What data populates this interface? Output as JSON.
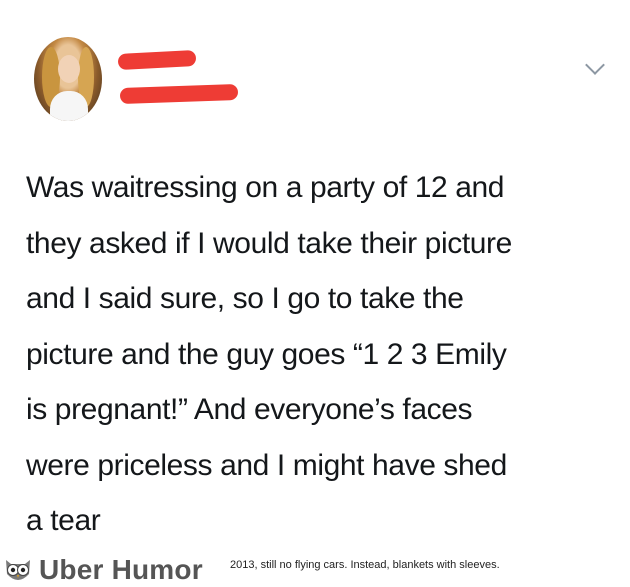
{
  "tweet": {
    "text": "Was waitressing on a party of 12 and\nthey asked if I would take their picture\nand I said sure, so I go to take the\npicture and the guy goes “1 2 3 Emily\nis pregnant!” And everyone’s faces\nwere priceless and I might have shed\na tear"
  },
  "footer": {
    "brand": "Uber Humor",
    "tagline": "2013, still no flying cars. Instead, blankets with sleeves."
  },
  "icons": {
    "menu": "chevron-down-icon",
    "logo": "owl-icon"
  },
  "colors": {
    "redaction": "#ee3c35",
    "text": "#14171a",
    "brand": "#555555"
  }
}
